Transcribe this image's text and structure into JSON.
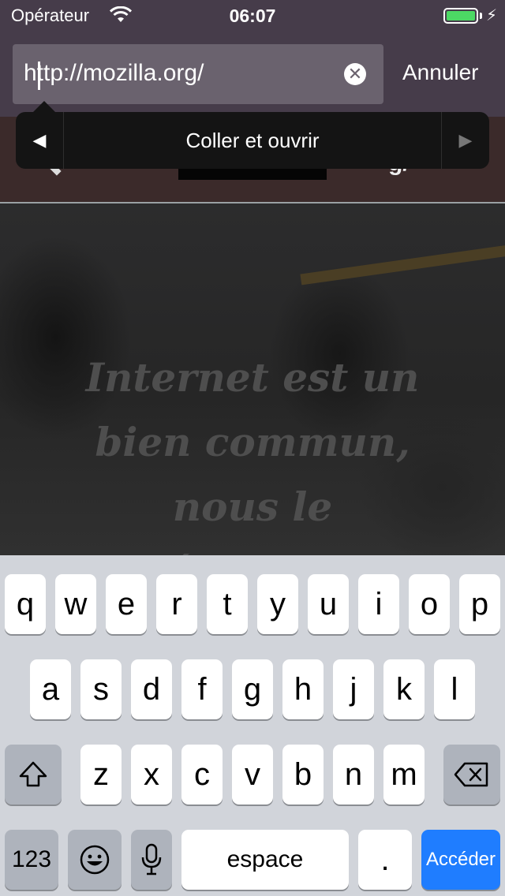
{
  "status_bar": {
    "carrier": "Opérateur",
    "time": "06:07"
  },
  "url_bar": {
    "value": "http://mozilla.org/",
    "cancel_label": "Annuler"
  },
  "edit_menu": {
    "item_label": "Coller et ouvrir"
  },
  "page": {
    "header_partial": "g/",
    "headline_lines": [
      "Internet est un",
      "bien commun,",
      "nous le",
      "défendons"
    ]
  },
  "keyboard": {
    "row1": [
      "q",
      "w",
      "e",
      "r",
      "t",
      "y",
      "u",
      "i",
      "o",
      "p"
    ],
    "row2": [
      "a",
      "s",
      "d",
      "f",
      "g",
      "h",
      "j",
      "k",
      "l"
    ],
    "row3": [
      "z",
      "x",
      "c",
      "v",
      "b",
      "n",
      "m"
    ],
    "numbers_label": "123",
    "space_label": "espace",
    "period_label": ".",
    "go_label": "Accéder"
  },
  "colors": {
    "chrome": "#463c4a",
    "url_field": "#6a626e",
    "keyboard_bg": "#d1d4da",
    "go_key": "#1f7dff"
  }
}
